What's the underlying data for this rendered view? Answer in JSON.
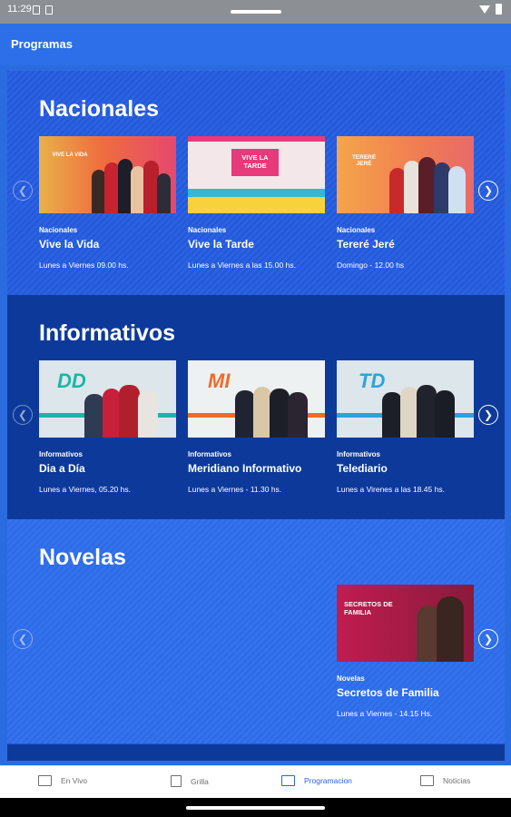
{
  "status_bar": {
    "time": "11:29"
  },
  "app_bar": {
    "title": "Programas"
  },
  "sections": [
    {
      "title": "Nacionales",
      "cards": [
        {
          "category": "Nacionales",
          "name": "Vive la Vida",
          "schedule": "Lunes a Viernes 09.00 hs.",
          "thumb_text": "VIVE LA VIDA"
        },
        {
          "category": "Nacionales",
          "name": "Vive la Tarde",
          "schedule": "Lunes a Viernes a las 15.00 hs.",
          "thumb_text": "VIVE LA TARDE"
        },
        {
          "category": "Nacionales",
          "name": "Tereré Jeré",
          "schedule": "Domingo - 12.00 hs",
          "thumb_text": "TERERÉ JERÉ"
        }
      ]
    },
    {
      "title": "Informativos",
      "cards": [
        {
          "category": "Informativos",
          "name": "Dia a Día",
          "schedule": "Lunes a Viernes, 05.20 hs.",
          "thumb_text": "DD"
        },
        {
          "category": "Informativos",
          "name": "Meridiano Informativo",
          "schedule": "Lunes a Viernes - 11.30 hs.",
          "thumb_text": "MI"
        },
        {
          "category": "Informativos",
          "name": "Telediario",
          "schedule": "Lunes a Virenes a las 18.45 hs.",
          "thumb_text": "TD"
        }
      ]
    },
    {
      "title": "Novelas",
      "cards": [
        {
          "category": "Novelas",
          "name": "Secretos de Familia",
          "schedule": "Lunes a Viernes - 14.15 Hs.",
          "thumb_text": "SECRETOS DE FAMILIA"
        }
      ]
    }
  ],
  "bottom_nav": {
    "items": [
      {
        "label": "En Vivo",
        "icon": "tv-icon"
      },
      {
        "label": "Grilla",
        "icon": "calendar-icon"
      },
      {
        "label": "Programacion",
        "icon": "schedule-list-icon",
        "active": true
      },
      {
        "label": "Noticias",
        "icon": "news-icon"
      }
    ]
  },
  "colors": {
    "primary": "#2d6fe8",
    "dark_band": "#0d3a9a",
    "active_nav": "#2563eb"
  }
}
